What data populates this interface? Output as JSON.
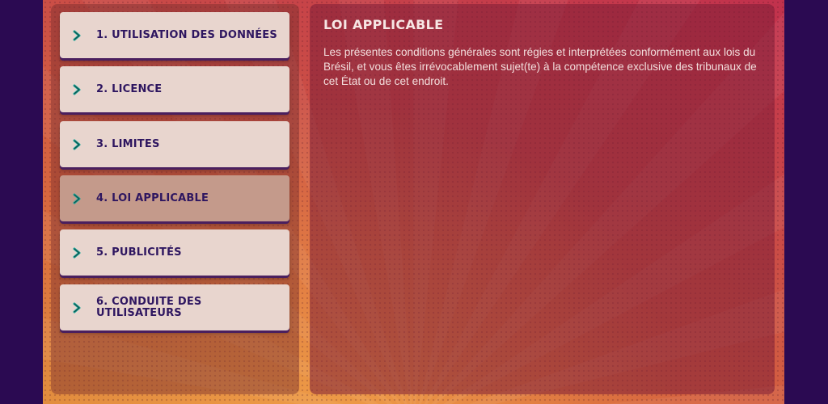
{
  "menu": {
    "items": [
      {
        "label": "1. UTILISATION DES DONNÉES",
        "active": false
      },
      {
        "label": "2. LICENCE",
        "active": false
      },
      {
        "label": "3. LIMITES",
        "active": false
      },
      {
        "label": "4. LOI APPLICABLE",
        "active": true
      },
      {
        "label": "5. PUBLICITÉS",
        "active": false
      },
      {
        "label": "6. CONDUITE DES UTILISATEURS",
        "active": false
      }
    ]
  },
  "content": {
    "title": "LOI APPLICABLE",
    "body": "Les présentes conditions générales sont régies et interprétées conformément aux lois du Brésil, et vous êtes irrévocablement sujet(te) à la compétence exclusive des tribunaux de cet État ou de cet endroit."
  },
  "colors": {
    "page_background": "#2b0a52",
    "item_background": "#e8d5ce",
    "active_item_background": "#c49a8b",
    "label_text": "#2e1660",
    "chevron": "#1aa89a"
  },
  "icons": {
    "menu_chevron": "chevron-right-icon"
  }
}
